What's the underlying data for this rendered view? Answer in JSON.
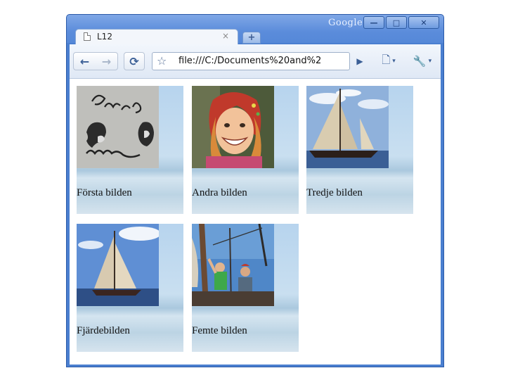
{
  "window": {
    "google_label": "Google",
    "buttons": {
      "minimize": "—",
      "maximize": "□",
      "close": "✕"
    }
  },
  "tab": {
    "title": "L12",
    "close_glyph": "×",
    "new_tab_glyph": "+"
  },
  "toolbar": {
    "back_glyph": "←",
    "forward_glyph": "→",
    "reload_glyph": "⟳",
    "star_glyph": "☆",
    "url": "file:///C:/Documents%20and%2",
    "go_glyph": "▶",
    "page_glyph": "🗋",
    "wrench_glyph": "🔧",
    "caret": "▾"
  },
  "gallery": [
    {
      "caption": "Första bilden",
      "image": "sketch-faces-image"
    },
    {
      "caption": "Andra bilden",
      "image": "smiling-child-image"
    },
    {
      "caption": "Tredje bilden",
      "image": "sailboat-image"
    },
    {
      "caption": "Fjärdebilden",
      "image": "sailboat-image-2"
    },
    {
      "caption": "Femte bilden",
      "image": "sailors-rigging-image"
    }
  ]
}
